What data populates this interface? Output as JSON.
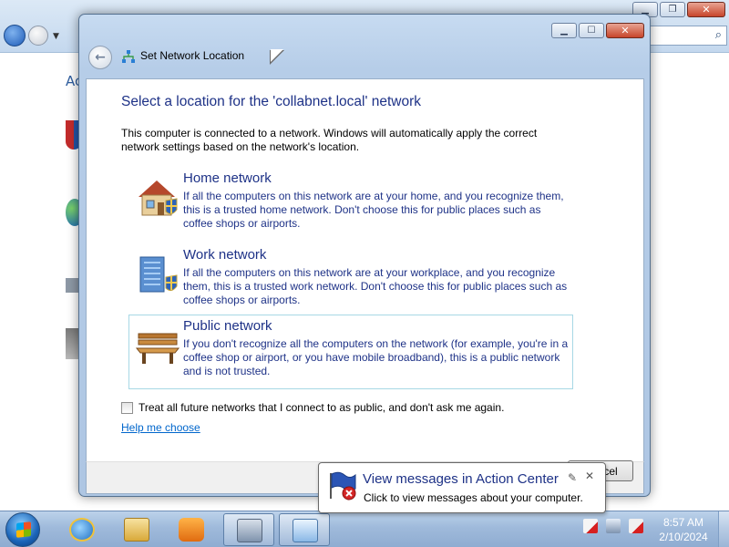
{
  "background_window": {
    "left_text": "Ac",
    "search_icon": "search-icon"
  },
  "dialog": {
    "title": "Set Network Location",
    "heading": "Select a location for the 'collabnet.local' network",
    "intro": "This computer is connected to a network. Windows will automatically apply the correct network settings based on the network's location.",
    "options": [
      {
        "title": "Home network",
        "description": "If all the computers on this network are at your home, and you recognize them, this is a trusted home network.  Don't choose this for public places such as coffee shops or airports.",
        "icon": "house-shield-icon"
      },
      {
        "title": "Work network",
        "description": "If all the computers on this network are at your workplace, and you recognize them, this is a trusted work network.  Don't choose this for public places such as coffee shops or airports.",
        "icon": "office-building-shield-icon"
      },
      {
        "title": "Public network",
        "description": "If you don't recognize all the computers on the network (for example, you're in a coffee shop or airport, or you have mobile broadband), this is a public network and is not trusted.",
        "icon": "park-bench-icon"
      }
    ],
    "checkbox_label": "Treat all future networks that I connect to as public, and don't ask me again.",
    "checkbox_checked": false,
    "help_link": "Help me choose",
    "cancel_label": "Cancel",
    "cancel_visible_text": "cel"
  },
  "balloon": {
    "title": "View messages in Action Center",
    "text": "Click to view messages about your computer."
  },
  "taskbar": {
    "clock_time": "8:57 AM",
    "clock_date": "2/10/2024",
    "items": [
      "internet-explorer-icon",
      "file-explorer-icon",
      "media-player-icon",
      "network-computer-icon",
      "control-panel-icon"
    ]
  },
  "colors": {
    "heading_blue": "#1e3287",
    "link_blue": "#0066cc",
    "hover_border": "#a7d8e5"
  }
}
